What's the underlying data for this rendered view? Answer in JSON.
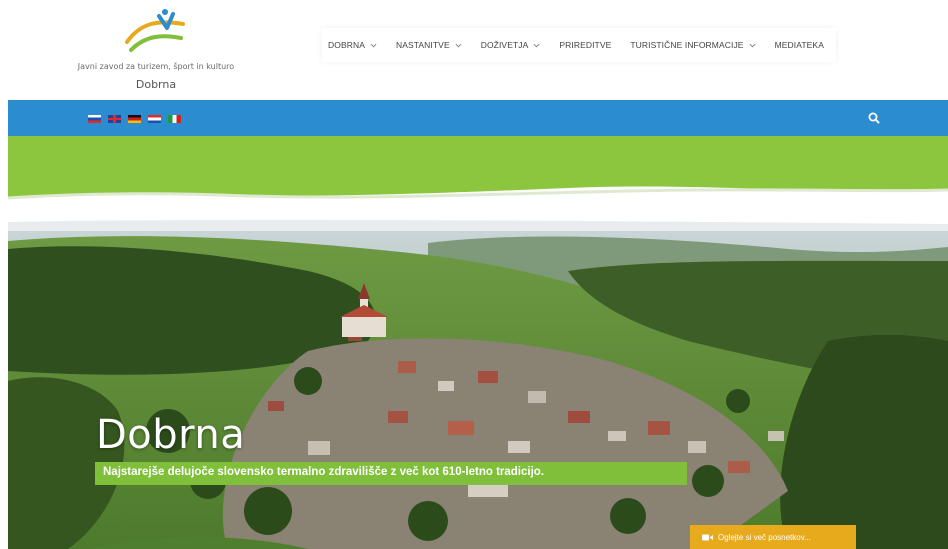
{
  "header": {
    "logo_line1": "Javni zavod za turizem, šport in kulturo",
    "logo_line2": "Dobrna",
    "logo_colors": {
      "blue": "#2b8ccf",
      "green": "#7fbf3a",
      "orange": "#e7aa1c"
    },
    "nav": [
      {
        "label": "DOBRNA",
        "has_dropdown": true
      },
      {
        "label": "NASTANITVE",
        "has_dropdown": true
      },
      {
        "label": "DOŽIVETJA",
        "has_dropdown": true
      },
      {
        "label": "PRIREDITVE",
        "has_dropdown": false
      },
      {
        "label": "TURISTIČNE INFORMACIJE",
        "has_dropdown": true
      },
      {
        "label": "MEDIATEKA",
        "has_dropdown": false
      }
    ]
  },
  "topbar": {
    "color": "#2b8ccf",
    "languages": [
      {
        "code": "sl",
        "icon": "slovenia-flag-icon"
      },
      {
        "code": "en",
        "icon": "uk-flag-icon"
      },
      {
        "code": "de",
        "icon": "germany-flag-icon"
      },
      {
        "code": "hr",
        "icon": "croatia-flag-icon"
      },
      {
        "code": "it",
        "icon": "italy-flag-icon"
      }
    ],
    "search_icon": "search-icon"
  },
  "band": {
    "color": "#8cc63f"
  },
  "hero": {
    "title": "Dobrna",
    "subtitle": "Najstarejše delujoče slovensko termalno zdravilišče z več kot 610-letno tradicijo.",
    "subtitle_bg": "#7fbf3a",
    "video_button_label": "Oglejte si več posnetkov...",
    "video_button_bg": "#e7aa1c",
    "video_icon": "video-camera-icon"
  }
}
